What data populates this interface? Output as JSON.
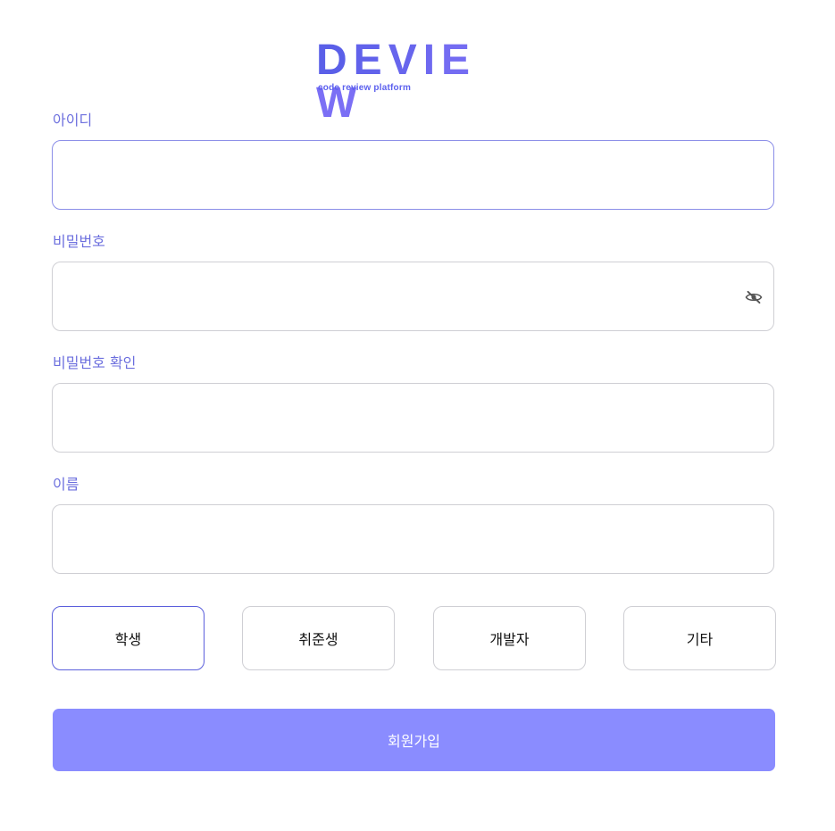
{
  "logo": {
    "letters": [
      "D",
      "E",
      "V",
      "I",
      "E",
      "W"
    ],
    "tagline": "code review platform"
  },
  "fields": {
    "id": {
      "label": "아이디",
      "value": ""
    },
    "password": {
      "label": "비밀번호",
      "value": ""
    },
    "password_confirm": {
      "label": "비밀번호 확인",
      "value": ""
    },
    "name": {
      "label": "이름",
      "value": ""
    }
  },
  "roles": {
    "options": [
      "학생",
      "취준생",
      "개발자",
      "기타"
    ],
    "selected": "학생"
  },
  "submit_label": "회원가입",
  "colors": {
    "accent": "#6c6fde",
    "button": "#8a8cff",
    "selected_border": "#5b5fdc",
    "logo_start": "#5a5fe8",
    "logo_end": "#7b6ff5"
  },
  "icons": {
    "password_toggle": "eye-slash-icon"
  }
}
